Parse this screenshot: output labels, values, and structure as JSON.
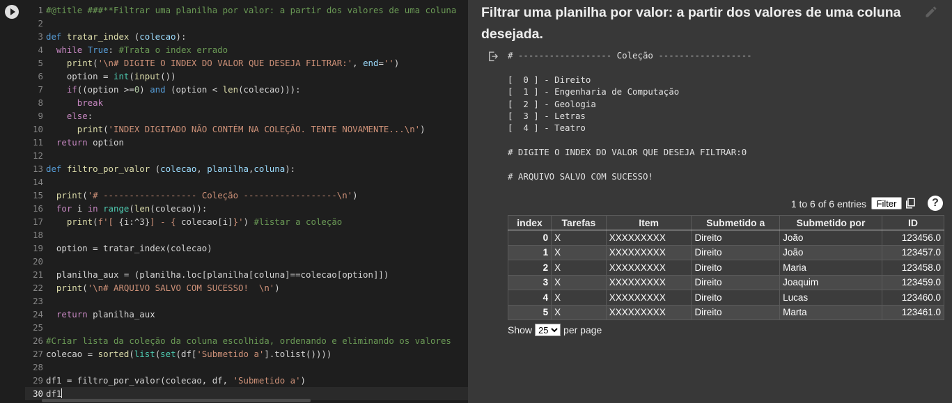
{
  "editor": {
    "lines": [
      {
        "n": "1",
        "tokens": [
          {
            "t": "#@title ###**Filtrar uma planilha por valor: a partir dos valores de uma coluna",
            "c": "c"
          }
        ]
      },
      {
        "n": "2",
        "tokens": []
      },
      {
        "n": "3",
        "tokens": [
          {
            "t": "def ",
            "c": "k"
          },
          {
            "t": "tratar_index",
            "c": "f"
          },
          {
            "t": " (",
            "c": ""
          },
          {
            "t": "colecao",
            "c": "v"
          },
          {
            "t": "):",
            "c": ""
          }
        ]
      },
      {
        "n": "4",
        "tokens": [
          {
            "t": "  ",
            "c": ""
          },
          {
            "t": "while ",
            "c": "kc"
          },
          {
            "t": "True",
            "c": "k"
          },
          {
            "t": ": ",
            "c": ""
          },
          {
            "t": "#Trata o index errado",
            "c": "c"
          }
        ]
      },
      {
        "n": "5",
        "tokens": [
          {
            "t": "    ",
            "c": ""
          },
          {
            "t": "print",
            "c": "f"
          },
          {
            "t": "(",
            "c": ""
          },
          {
            "t": "'\\n# DIGITE O INDEX DO VALOR QUE DESEJA FILTRAR:'",
            "c": "s"
          },
          {
            "t": ", ",
            "c": ""
          },
          {
            "t": "end",
            "c": "v"
          },
          {
            "t": "=",
            "c": ""
          },
          {
            "t": "''",
            "c": "s"
          },
          {
            "t": ")",
            "c": ""
          }
        ]
      },
      {
        "n": "6",
        "tokens": [
          {
            "t": "    option = ",
            "c": ""
          },
          {
            "t": "int",
            "c": "b"
          },
          {
            "t": "(",
            "c": ""
          },
          {
            "t": "input",
            "c": "f"
          },
          {
            "t": "())",
            "c": ""
          }
        ]
      },
      {
        "n": "7",
        "tokens": [
          {
            "t": "    ",
            "c": ""
          },
          {
            "t": "if",
            "c": "kc"
          },
          {
            "t": "((option >=",
            "c": ""
          },
          {
            "t": "0",
            "c": "n"
          },
          {
            "t": ") ",
            "c": ""
          },
          {
            "t": "and",
            "c": "k"
          },
          {
            "t": " (option < ",
            "c": ""
          },
          {
            "t": "len",
            "c": "f"
          },
          {
            "t": "(colecao))):",
            "c": ""
          }
        ]
      },
      {
        "n": "8",
        "tokens": [
          {
            "t": "      ",
            "c": ""
          },
          {
            "t": "break",
            "c": "kc"
          }
        ]
      },
      {
        "n": "9",
        "tokens": [
          {
            "t": "    ",
            "c": ""
          },
          {
            "t": "else",
            "c": "kc"
          },
          {
            "t": ":",
            "c": ""
          }
        ]
      },
      {
        "n": "10",
        "tokens": [
          {
            "t": "      ",
            "c": ""
          },
          {
            "t": "print",
            "c": "f"
          },
          {
            "t": "(",
            "c": ""
          },
          {
            "t": "'INDEX DIGITADO NÃO CONTÉM NA COLEÇÃO. TENTE NOVAMENTE...\\n'",
            "c": "s"
          },
          {
            "t": ")",
            "c": ""
          }
        ]
      },
      {
        "n": "11",
        "tokens": [
          {
            "t": "  ",
            "c": ""
          },
          {
            "t": "return",
            "c": "kc"
          },
          {
            "t": " option",
            "c": ""
          }
        ]
      },
      {
        "n": "12",
        "tokens": []
      },
      {
        "n": "13",
        "tokens": [
          {
            "t": "def ",
            "c": "k"
          },
          {
            "t": "filtro_por_valor",
            "c": "f"
          },
          {
            "t": " (",
            "c": ""
          },
          {
            "t": "colecao",
            "c": "v"
          },
          {
            "t": ", ",
            "c": ""
          },
          {
            "t": "planilha",
            "c": "v"
          },
          {
            "t": ",",
            "c": ""
          },
          {
            "t": "coluna",
            "c": "v"
          },
          {
            "t": "):",
            "c": ""
          }
        ]
      },
      {
        "n": "14",
        "tokens": []
      },
      {
        "n": "15",
        "tokens": [
          {
            "t": "  ",
            "c": ""
          },
          {
            "t": "print",
            "c": "f"
          },
          {
            "t": "(",
            "c": ""
          },
          {
            "t": "'# ------------------ Coleção ------------------\\n'",
            "c": "s"
          },
          {
            "t": ")",
            "c": ""
          }
        ]
      },
      {
        "n": "16",
        "tokens": [
          {
            "t": "  ",
            "c": ""
          },
          {
            "t": "for",
            "c": "kc"
          },
          {
            "t": " i ",
            "c": ""
          },
          {
            "t": "in",
            "c": "kc"
          },
          {
            "t": " ",
            "c": ""
          },
          {
            "t": "range",
            "c": "b"
          },
          {
            "t": "(",
            "c": ""
          },
          {
            "t": "len",
            "c": "f"
          },
          {
            "t": "(colecao)):",
            "c": ""
          }
        ]
      },
      {
        "n": "17",
        "tokens": [
          {
            "t": "    ",
            "c": ""
          },
          {
            "t": "print",
            "c": "f"
          },
          {
            "t": "(",
            "c": ""
          },
          {
            "t": "f'[ ",
            "c": "s"
          },
          {
            "t": "{i:^3}",
            "c": ""
          },
          {
            "t": "] - { ",
            "c": "s"
          },
          {
            "t": "colecao[i]",
            "c": ""
          },
          {
            "t": "}'",
            "c": "s"
          },
          {
            "t": ") ",
            "c": ""
          },
          {
            "t": "#listar a coleção",
            "c": "c"
          }
        ]
      },
      {
        "n": "18",
        "tokens": []
      },
      {
        "n": "19",
        "tokens": [
          {
            "t": "  option = tratar_index(colecao)",
            "c": ""
          }
        ]
      },
      {
        "n": "20",
        "tokens": []
      },
      {
        "n": "21",
        "tokens": [
          {
            "t": "  planilha_aux = (planilha.loc[planilha[coluna]==colecao[option]])",
            "c": ""
          }
        ]
      },
      {
        "n": "22",
        "tokens": [
          {
            "t": "  ",
            "c": ""
          },
          {
            "t": "print",
            "c": "f"
          },
          {
            "t": "(",
            "c": ""
          },
          {
            "t": "'\\n# ARQUIVO SALVO COM SUCESSO!  \\n'",
            "c": "s"
          },
          {
            "t": ")",
            "c": ""
          }
        ]
      },
      {
        "n": "23",
        "tokens": []
      },
      {
        "n": "24",
        "tokens": [
          {
            "t": "  ",
            "c": ""
          },
          {
            "t": "return",
            "c": "kc"
          },
          {
            "t": " planilha_aux",
            "c": ""
          }
        ]
      },
      {
        "n": "25",
        "tokens": []
      },
      {
        "n": "26",
        "tokens": [
          {
            "t": "#Criar lista da coleção da coluna escolhida, ordenando e eliminando os valores",
            "c": "c"
          }
        ]
      },
      {
        "n": "27",
        "tokens": [
          {
            "t": "colecao = ",
            "c": ""
          },
          {
            "t": "sorted",
            "c": "f"
          },
          {
            "t": "(",
            "c": ""
          },
          {
            "t": "list",
            "c": "b"
          },
          {
            "t": "(",
            "c": ""
          },
          {
            "t": "set",
            "c": "b"
          },
          {
            "t": "(df[",
            "c": ""
          },
          {
            "t": "'Submetido a'",
            "c": "s"
          },
          {
            "t": "].tolist())))",
            "c": ""
          }
        ]
      },
      {
        "n": "28",
        "tokens": []
      },
      {
        "n": "29",
        "tokens": [
          {
            "t": "df1 = filtro_por_valor(colecao, df, ",
            "c": ""
          },
          {
            "t": "'Submetido a'",
            "c": "s"
          },
          {
            "t": ")",
            "c": ""
          }
        ]
      },
      {
        "n": "30",
        "tokens": [
          {
            "t": "df1",
            "c": ""
          }
        ],
        "current": true
      }
    ]
  },
  "output": {
    "form_title": "Filtrar uma planilha por valor: a partir dos valores de uma coluna desejada.",
    "stdout": "# ------------------ Coleção ------------------\n\n[  0 ] - Direito\n[  1 ] - Engenharia de Computação\n[  2 ] - Geologia\n[  3 ] - Letras\n[  4 ] - Teatro\n\n# DIGITE O INDEX DO VALOR QUE DESEJA FILTRAR:0\n\n# ARQUIVO SALVO COM SUCESSO!",
    "table": {
      "entries_info": "1 to 6 of 6 entries",
      "filter_label": "Filter",
      "help_label": "?",
      "columns": [
        "index",
        "Tarefas",
        "Item",
        "Submetido a",
        "Submetido por",
        "ID"
      ],
      "rows": [
        [
          "0",
          "X",
          "XXXXXXXXX",
          "Direito",
          "João",
          "123456.0"
        ],
        [
          "1",
          "X",
          "XXXXXXXXX",
          "Direito",
          "João",
          "123457.0"
        ],
        [
          "2",
          "X",
          "XXXXXXXXX",
          "Direito",
          "Maria",
          "123458.0"
        ],
        [
          "3",
          "X",
          "XXXXXXXXX",
          "Direito",
          "Joaquim",
          "123459.0"
        ],
        [
          "4",
          "X",
          "XXXXXXXXX",
          "Direito",
          "Lucas",
          "123460.0"
        ],
        [
          "5",
          "X",
          "XXXXXXXXX",
          "Direito",
          "Marta",
          "123461.0"
        ]
      ],
      "show_label": "Show",
      "page_size": "25",
      "per_page_label": "per page"
    }
  },
  "icons": {
    "run": "run-cell-icon",
    "edit": "pencil-icon",
    "output": "output-redirect-icon",
    "copy": "copy-icon",
    "help": "help-icon"
  }
}
